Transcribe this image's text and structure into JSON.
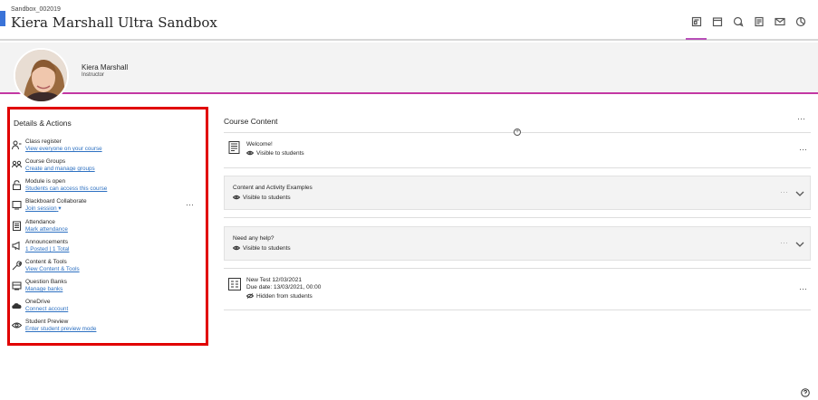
{
  "header": {
    "course_code": "Sandbox_002019",
    "course_title": "Kiera Marshall Ultra Sandbox",
    "nav_icons": [
      "content-icon",
      "calendar-icon",
      "discussions-icon",
      "gradebook-icon",
      "messages-icon",
      "analytics-icon"
    ]
  },
  "banner": {
    "instructor_name": "Kiera Marshall",
    "instructor_role": "Instructor"
  },
  "details": {
    "title": "Details & Actions",
    "items": [
      {
        "title": "Class register",
        "link": "View everyone on your course",
        "icon": "class-register-icon"
      },
      {
        "title": "Course Groups",
        "link": "Create and manage groups",
        "icon": "groups-icon"
      },
      {
        "title": "Module is open",
        "link": "Students can access this course",
        "icon": "lock-open-icon"
      },
      {
        "title": "Blackboard Collaborate",
        "link": "Join session",
        "icon": "collaborate-icon",
        "more": "···",
        "dropdown": "▾"
      },
      {
        "title": "Attendance",
        "link": "Mark attendance",
        "icon": "attendance-icon"
      },
      {
        "title": "Announcements",
        "link": "1 Posted | 1 Total",
        "icon": "megaphone-icon"
      },
      {
        "title": "Content & Tools",
        "link": "View Content & Tools",
        "icon": "wrench-icon"
      },
      {
        "title": "Question Banks",
        "link": "Manage banks",
        "icon": "question-bank-icon"
      },
      {
        "title": "OneDrive",
        "link": "Connect account",
        "icon": "cloud-icon"
      },
      {
        "title": "Student Preview",
        "link": "Enter student preview mode",
        "icon": "eye-icon"
      }
    ]
  },
  "content": {
    "title": "Course Content",
    "more": "···",
    "add": "+",
    "items": [
      {
        "title": "Welcome!",
        "status": "Visible to students",
        "more": "···"
      },
      {
        "title": "Content and Activity Examples",
        "status": "Visible to students",
        "more": "···"
      },
      {
        "title": "Need any help?",
        "status": "Visible to students",
        "more": "···"
      },
      {
        "title": "New Test 12/03/2021",
        "due": "Due date: 13/03/2021, 00:00",
        "status": "Hidden from students",
        "more": "···"
      }
    ]
  },
  "help": "?"
}
